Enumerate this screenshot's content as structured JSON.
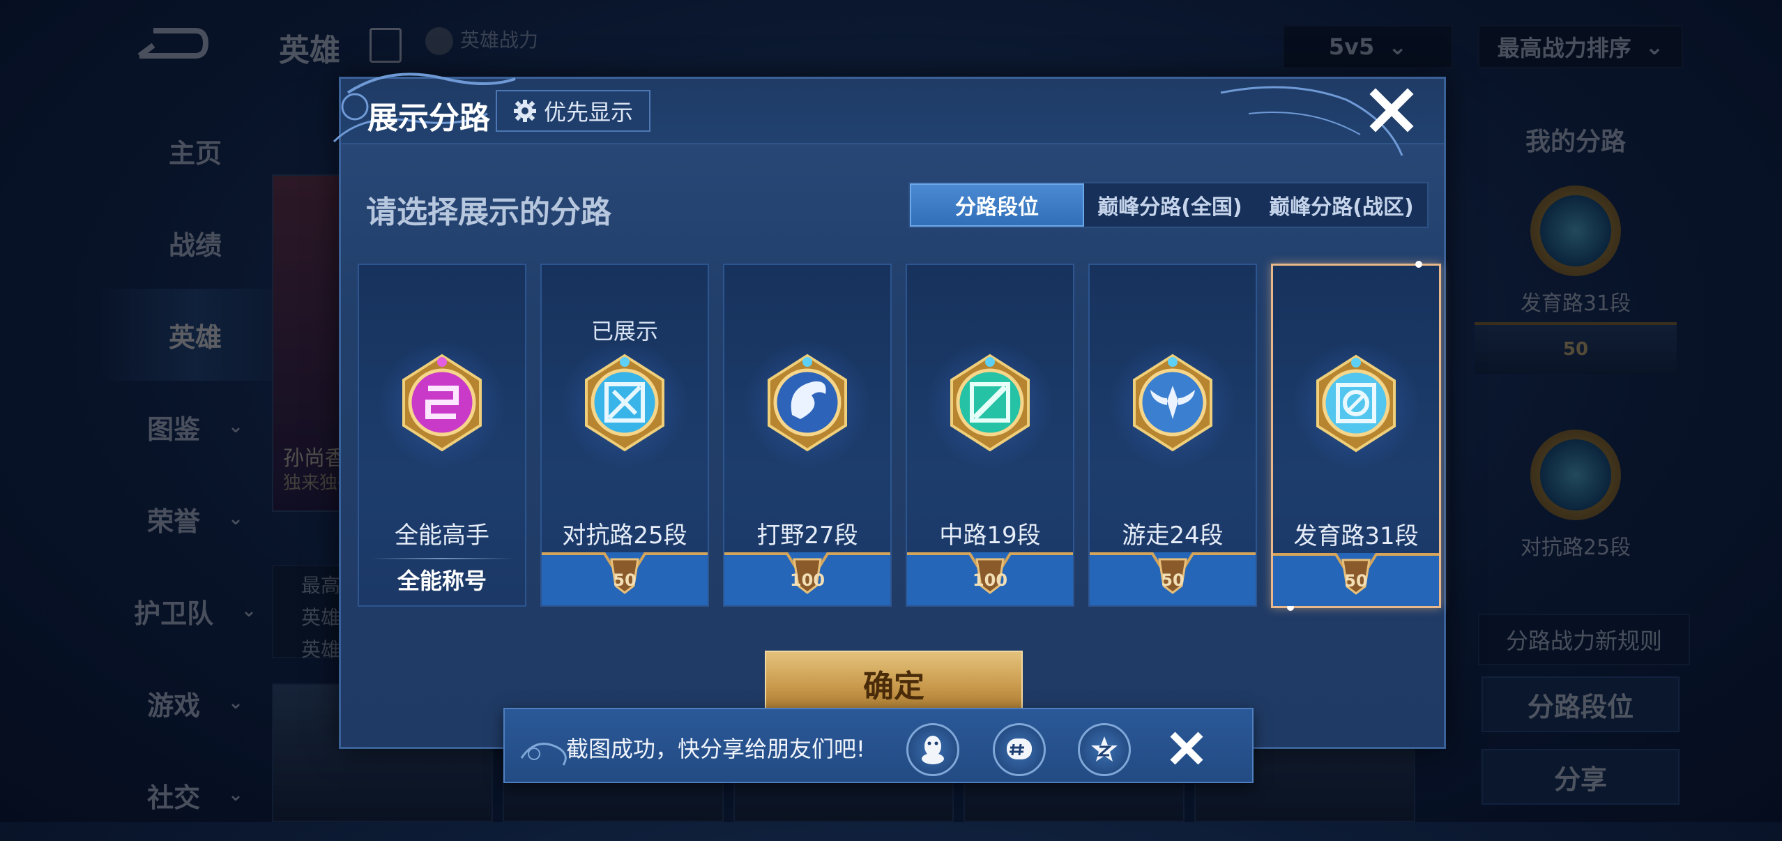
{
  "background": {
    "title": "英雄",
    "power_label": "英雄战力",
    "mode_select": "5v5",
    "sort_select": "最高战力排序",
    "nav": [
      {
        "label": "主页",
        "has_chevron": false,
        "active": false
      },
      {
        "label": "战绩",
        "has_chevron": false,
        "active": false
      },
      {
        "label": "英雄",
        "has_chevron": false,
        "active": true
      },
      {
        "label": "图鉴",
        "has_chevron": true,
        "active": false
      },
      {
        "label": "荣誉",
        "has_chevron": true,
        "active": false
      },
      {
        "label": "护卫队",
        "has_chevron": true,
        "active": false
      },
      {
        "label": "游戏",
        "has_chevron": true,
        "active": false
      },
      {
        "label": "社交",
        "has_chevron": true,
        "active": false
      }
    ],
    "hero_card": {
      "name": "孙尚香",
      "subtitle": "独来独往"
    },
    "hero_info": [
      "最高",
      "英雄",
      "英雄"
    ],
    "right_panel": {
      "title": "我的分路",
      "lane1_label": "发育路31段",
      "lane1_value": "50",
      "lane2_label": "对抗路25段",
      "rules_link": "分路战力新规则",
      "btn_lane_rank": "分路段位",
      "btn_share": "分享"
    }
  },
  "modal": {
    "title": "展示分路",
    "priority_button": "优先显示",
    "subtitle": "请选择展示的分路",
    "tabs": [
      {
        "label": "分路段位",
        "active": true
      },
      {
        "label": "巅峰分路(全国)",
        "active": false
      },
      {
        "label": "巅峰分路(战区)",
        "active": false
      }
    ],
    "cards": [
      {
        "name": "全能高手",
        "bottom_label": "全能称号",
        "shown": "",
        "value": "",
        "emblem": "all-round-icon",
        "color": "#c93ac9",
        "selected": false
      },
      {
        "name": "对抗路25段",
        "bottom_label": "",
        "shown": "已展示",
        "value": "50",
        "emblem": "clash-lane-icon",
        "color": "#39b4e8",
        "selected": false
      },
      {
        "name": "打野27段",
        "bottom_label": "",
        "shown": "",
        "value": "100",
        "emblem": "jungle-icon",
        "color": "#2d63b8",
        "selected": false
      },
      {
        "name": "中路19段",
        "bottom_label": "",
        "shown": "",
        "value": "100",
        "emblem": "mid-lane-icon",
        "color": "#25c2a6",
        "selected": false
      },
      {
        "name": "游走24段",
        "bottom_label": "",
        "shown": "",
        "value": "50",
        "emblem": "roam-icon",
        "color": "#3a7fd0",
        "selected": false
      },
      {
        "name": "发育路31段",
        "bottom_label": "",
        "shown": "",
        "value": "50",
        "emblem": "farm-lane-icon",
        "color": "#52c6ee",
        "selected": true
      }
    ],
    "confirm": "确定"
  },
  "toast": {
    "message": "截图成功，快分享给朋友们吧!"
  }
}
